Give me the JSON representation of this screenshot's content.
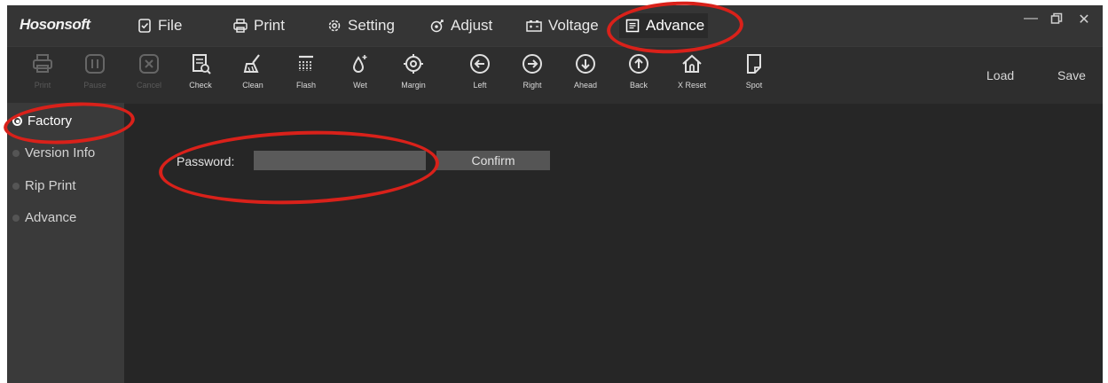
{
  "app": {
    "logo": "Hosonsoft"
  },
  "menus": [
    {
      "label": "File",
      "icon": "file-check-icon"
    },
    {
      "label": "Print",
      "icon": "printer-icon"
    },
    {
      "label": "Setting",
      "icon": "gear-icon"
    },
    {
      "label": "Adjust",
      "icon": "adjust-icon"
    },
    {
      "label": "Voltage",
      "icon": "battery-icon"
    },
    {
      "label": "Advance",
      "icon": "document-icon",
      "active": true
    }
  ],
  "window_controls": [
    "minimize-icon",
    "restore-icon",
    "close-icon"
  ],
  "toolbar": {
    "items": [
      {
        "label": "Print",
        "icon": "printer-icon",
        "enabled": false
      },
      {
        "label": "Pause",
        "icon": "pause-icon",
        "enabled": false
      },
      {
        "label": "Cancel",
        "icon": "cancel-icon",
        "enabled": false
      },
      {
        "label": "Check",
        "icon": "check-document-icon",
        "enabled": true
      },
      {
        "label": "Clean",
        "icon": "brush-icon",
        "enabled": true
      },
      {
        "label": "Flash",
        "icon": "flash-grid-icon",
        "enabled": true
      },
      {
        "label": "Wet",
        "icon": "droplet-icon",
        "enabled": true
      },
      {
        "label": "Margin",
        "icon": "target-icon",
        "enabled": true
      },
      {
        "label": "Left",
        "icon": "arrow-left-icon",
        "enabled": true
      },
      {
        "label": "Right",
        "icon": "arrow-right-icon",
        "enabled": true
      },
      {
        "label": "Ahead",
        "icon": "arrow-down-icon",
        "enabled": true
      },
      {
        "label": "Back",
        "icon": "arrow-up-icon",
        "enabled": true
      },
      {
        "label": "X Reset",
        "icon": "home-icon",
        "enabled": true
      },
      {
        "label": "Spot",
        "icon": "page-icon",
        "enabled": true
      }
    ],
    "load_label": "Load",
    "save_label": "Save"
  },
  "sidebar": {
    "items": [
      {
        "label": "Factory",
        "active": true
      },
      {
        "label": "Version Info",
        "active": false
      },
      {
        "label": "Rip Print",
        "active": false
      },
      {
        "label": "Advance",
        "active": false
      }
    ]
  },
  "factory": {
    "password_label": "Password:",
    "password_value": "",
    "confirm_label": "Confirm"
  },
  "colors": {
    "annotation": "#d9211a",
    "background": "#262626",
    "menubar": "#353535",
    "sidebar": "#3a3a3a"
  }
}
